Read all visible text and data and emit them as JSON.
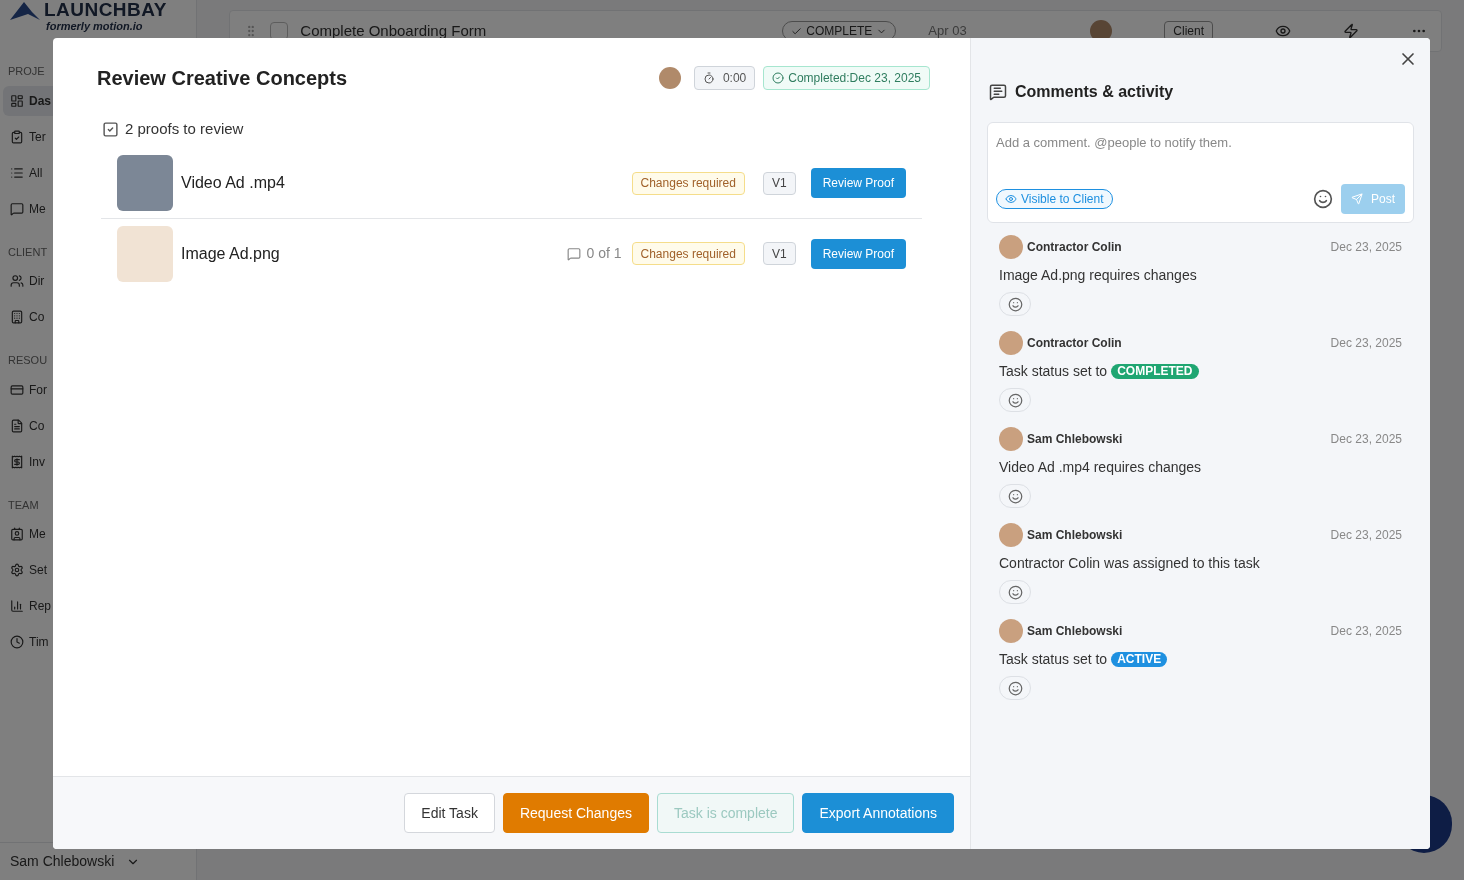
{
  "background": {
    "logo": "LAUNCHBAY",
    "logo_subtitle": "formerly motion.io",
    "sidebar_sections": [
      {
        "heading": "PROJE",
        "items": [
          {
            "label": "Das",
            "selected": true
          },
          {
            "label": "Ter",
            "selected": false
          },
          {
            "label": "All",
            "selected": false
          },
          {
            "label": "Me",
            "selected": false
          }
        ]
      },
      {
        "heading": "CLIENT",
        "items": [
          {
            "label": "Dir",
            "selected": false
          },
          {
            "label": "Co",
            "selected": false
          }
        ]
      },
      {
        "heading": "RESOU",
        "items": [
          {
            "label": "For",
            "selected": false
          },
          {
            "label": "Co",
            "selected": false
          },
          {
            "label": "Inv",
            "selected": false
          }
        ]
      },
      {
        "heading": "TEAM",
        "items": [
          {
            "label": "Me",
            "selected": false
          },
          {
            "label": "Set",
            "selected": false
          },
          {
            "label": "Rep",
            "selected": false
          },
          {
            "label": "Tim",
            "selected": false
          }
        ]
      }
    ],
    "user": "Sam Chlebowski",
    "task_row": {
      "checked": false,
      "title": "Complete Onboarding Form",
      "status": "COMPLETE",
      "date": "Apr 03",
      "tag": "Client"
    }
  },
  "task": {
    "title": "Review Creative Concepts",
    "timer": "0:00",
    "completed": "Completed:Dec 23, 2025",
    "proofs_heading": "2 proofs to review",
    "proofs": [
      {
        "name": "Video Ad .mp4",
        "status": "Changes required",
        "version": "V1",
        "action": "Review Proof"
      },
      {
        "name": "Image Ad.png",
        "comment_count": "0 of 1",
        "status": "Changes required",
        "version": "V1",
        "action": "Review Proof"
      }
    ]
  },
  "footer_buttons": [
    {
      "label": "Edit Task",
      "kind": "secondary"
    },
    {
      "label": "Request Changes",
      "kind": "warning"
    },
    {
      "label": "Task is complete",
      "kind": "disabled"
    },
    {
      "label": "Export Annotations",
      "kind": "primary"
    }
  ],
  "comments": {
    "title": "Comments & activity",
    "placeholder": "Add a comment. @people to notify them.",
    "visibility": "Visible to Client",
    "post": "Post",
    "entries": [
      {
        "author": "Contractor Colin",
        "date": "Dec 23, 2025",
        "text": "Image Ad.png requires changes"
      },
      {
        "author": "Contractor Colin",
        "date": "Dec 23, 2025",
        "text": "Task status set to",
        "status": {
          "label": "COMPLETED",
          "color": "#1fa672"
        }
      },
      {
        "author": "Sam Chlebowski",
        "date": "Dec 23, 2025",
        "text": "Video Ad .mp4 requires changes"
      },
      {
        "author": "Sam Chlebowski",
        "date": "Dec 23, 2025",
        "text": "Contractor Colin was assigned to this task"
      },
      {
        "author": "Sam Chlebowski",
        "date": "Dec 23, 2025",
        "text": "Task status set to",
        "status": {
          "label": "ACTIVE",
          "color": "#1e90e0"
        }
      }
    ]
  }
}
